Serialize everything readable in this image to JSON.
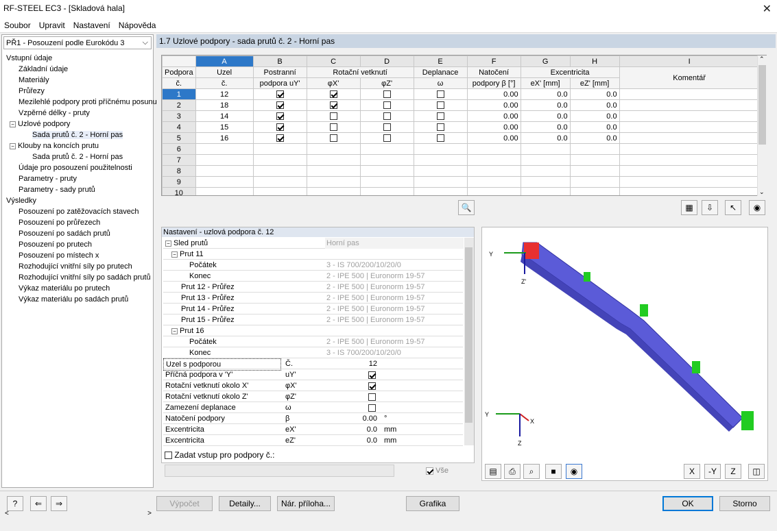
{
  "window": {
    "title": "RF-STEEL EC3 - [Skladová hala]"
  },
  "menu": [
    "Soubor",
    "Upravit",
    "Nastavení",
    "Nápověda"
  ],
  "case_combo": "PŘ1 - Posouzení podle Eurokódu 3",
  "tree": {
    "input_root": "Vstupní údaje",
    "input_items": [
      "Základní údaje",
      "Materiály",
      "Průřezy",
      "Mezilehlé podpory proti příčnému posunu",
      "Vzpěrné délky - pruty"
    ],
    "nodal_supports": "Uzlové podpory",
    "nodal_supports_child": "Sada prutů č. 2 - Horní pas",
    "hinges": "Klouby na koncích prutu",
    "hinges_child": "Sada prutů č. 2 - Horní pas",
    "input_items2": [
      "Údaje pro posouzení použitelnosti",
      "Parametry - pruty",
      "Parametry - sady prutů"
    ],
    "results_root": "Výsledky",
    "results_items": [
      "Posouzení po zatěžovacích stavech",
      "Posouzení po průřezech",
      "Posouzení po sadách prutů",
      "Posouzení po prutech",
      "Posouzení po místech x",
      "Rozhodující vnitřní síly po prutech",
      "Rozhodující vnitřní síly po sadách prutů",
      "Výkaz materiálu po prutech",
      "Výkaz materiálu po sadách prutů"
    ]
  },
  "panel_title": "1.7 Uzlové podpory - sada prutů č. 2 - Horní pas",
  "grid": {
    "col_letters": [
      "A",
      "B",
      "C",
      "D",
      "E",
      "F",
      "G",
      "H",
      "I"
    ],
    "hdr": {
      "support": "Podpora",
      "support2": "č.",
      "node": "Uzel",
      "node2": "č.",
      "lateral": "Postranní",
      "lateral2": "podpora uY'",
      "rot": "Rotační vetknutí",
      "phix": "φX'",
      "phiz": "φZ'",
      "warp": "Deplanace",
      "omega": "ω",
      "rotation": "Natočení",
      "rotation2": "podpory β [°]",
      "ecc": "Excentricita",
      "ex": "eX' [mm]",
      "ez": "eZ' [mm]",
      "comment": "Komentář"
    },
    "rows": [
      {
        "no": "1",
        "node": "12",
        "uy": true,
        "phix": true,
        "phiz": false,
        "omega": false,
        "beta": "0.00",
        "ex": "0.0",
        "ez": "0.0"
      },
      {
        "no": "2",
        "node": "18",
        "uy": true,
        "phix": true,
        "phiz": false,
        "omega": false,
        "beta": "0.00",
        "ex": "0.0",
        "ez": "0.0"
      },
      {
        "no": "3",
        "node": "14",
        "uy": true,
        "phix": false,
        "phiz": false,
        "omega": false,
        "beta": "0.00",
        "ex": "0.0",
        "ez": "0.0"
      },
      {
        "no": "4",
        "node": "15",
        "uy": true,
        "phix": false,
        "phiz": false,
        "omega": false,
        "beta": "0.00",
        "ex": "0.0",
        "ez": "0.0"
      },
      {
        "no": "5",
        "node": "16",
        "uy": true,
        "phix": false,
        "phiz": false,
        "omega": false,
        "beta": "0.00",
        "ex": "0.0",
        "ez": "0.0"
      },
      {
        "no": "6"
      },
      {
        "no": "7"
      },
      {
        "no": "8"
      },
      {
        "no": "9"
      },
      {
        "no": "10"
      }
    ]
  },
  "settings": {
    "title": "Nastavení - uzlová podpora č. 12",
    "member_sequence": "Sled prutů",
    "member_sequence_val": "Horní pas",
    "member11": "Prut 11",
    "start": "Počátek",
    "start11_val": "3 - IS 700/200/10/20/0",
    "end": "Konec",
    "end11_val": "2 - IPE 500 | Euronorm 19-57",
    "m12": "Prut 12 - Průřez",
    "m12_val": "2 - IPE 500 | Euronorm 19-57",
    "m13": "Prut 13 - Průřez",
    "m13_val": "2 - IPE 500 | Euronorm 19-57",
    "m14": "Prut 14 - Průřez",
    "m14_val": "2 - IPE 500 | Euronorm 19-57",
    "m15": "Prut 15 - Průřez",
    "m15_val": "2 - IPE 500 | Euronorm 19-57",
    "member16": "Prut 16",
    "start16_val": "2 - IPE 500 | Euronorm 19-57",
    "end16_val": "3 - IS 700/200/10/20/0",
    "node_label": "Uzel s podporou",
    "node_sym": "Č.",
    "node_val": "12",
    "lat_label": "Příčná podpora v 'Y'",
    "lat_sym": "uY'",
    "rx_label": "Rotační vetknutí okolo X'",
    "rx_sym": "φX'",
    "rz_label": "Rotační vetknutí okolo Z'",
    "rz_sym": "φZ'",
    "warp_label": "Zamezení deplanace",
    "warp_sym": "ω",
    "rot_label": "Natočení podpory",
    "rot_sym": "β",
    "rot_val": "0.00",
    "rot_unit": "°",
    "ex_label": "Excentricita",
    "ex_sym": "eX'",
    "ex_val": "0.0",
    "ex_unit": "mm",
    "ez_label": "Excentricita",
    "ez_sym": "eZ'",
    "ez_val": "0.0",
    "ez_unit": "mm",
    "input_for": "Zadat vstup pro podpory č.:",
    "all": "Vše"
  },
  "graphic": {
    "axis_y": "Y",
    "axis_z": "Z'",
    "axis_y2": "Y",
    "axis_x2": "X",
    "axis_z2": "Z"
  },
  "buttons": {
    "calc": "Výpočet",
    "details": "Detaily...",
    "annex": "Nár. příloha...",
    "graphics": "Grafika",
    "ok": "OK",
    "cancel": "Storno"
  }
}
